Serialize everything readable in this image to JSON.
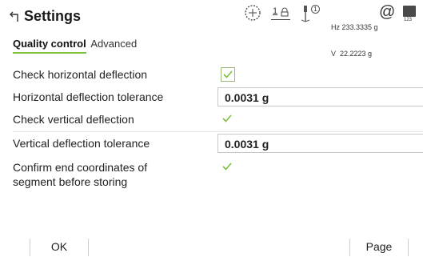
{
  "header": {
    "title": "Settings",
    "back_icon": "back-arrow-icon",
    "status": {
      "target_icon": "dotted-circle-target-icon",
      "face_label": "1",
      "prism_icon": "prism-pole-icon",
      "prism_number": "1",
      "hz": "Hz 233.3335 g",
      "v": "V  22.2223 g",
      "at_icon": "@",
      "battery_label": "123"
    }
  },
  "tabs": [
    {
      "label": "Quality control",
      "active": true
    },
    {
      "label": "Advanced",
      "active": false
    }
  ],
  "rows": [
    {
      "label": "Check horizontal deflection",
      "type": "checkbox",
      "checked": true
    },
    {
      "label": "Horizontal deflection tolerance",
      "type": "value",
      "value": "0.0031 g"
    },
    {
      "label": "Check vertical deflection",
      "type": "checkbox",
      "checked": true
    },
    {
      "label": "Vertical deflection tolerance",
      "type": "value",
      "value": "0.0031 g"
    },
    {
      "label_line1": "Confirm end coordinates of",
      "label_line2": "segment before storing",
      "type": "checkbox",
      "checked": true
    }
  ],
  "softkeys": {
    "ok": "OK",
    "page": "Page"
  },
  "colors": {
    "accent_green": "#7cbf3a",
    "check_green": "#7cbf3a"
  }
}
